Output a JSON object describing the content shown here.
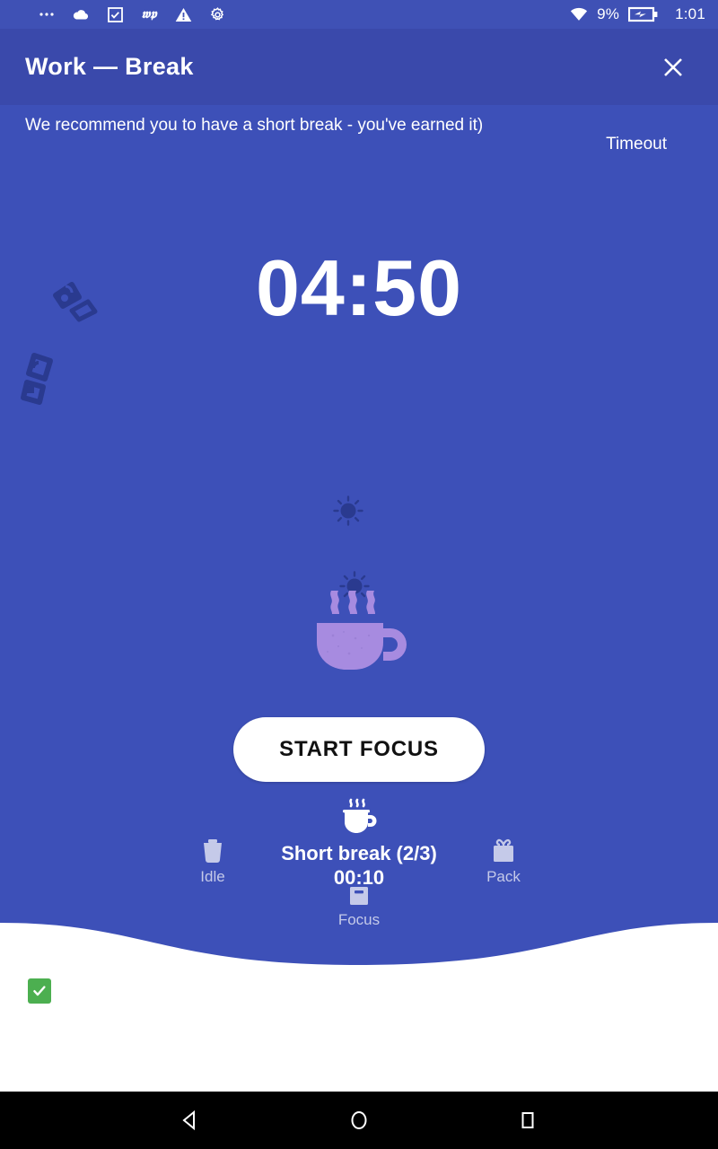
{
  "status_bar": {
    "left_icons": [
      {
        "name": "more-options-icon",
        "glyph": "dots"
      },
      {
        "name": "cloud-icon",
        "glyph": "cloud"
      },
      {
        "name": "checkbox-icon",
        "glyph": "checkbox"
      },
      {
        "name": "washington-post-icon",
        "glyph": "wp"
      },
      {
        "name": "warning-icon",
        "glyph": "warning"
      },
      {
        "name": "settings-gear-icon",
        "glyph": "gear"
      }
    ],
    "wifi_icon": "wifi-icon",
    "battery_percent": "9%",
    "battery_icon": "battery-charging-icon",
    "clock": "1:01"
  },
  "title_bar": {
    "title": "Work — Break",
    "close_label": "✕"
  },
  "break_screen": {
    "recommendation": "We recommend you to have a short break - you've earned it)",
    "timeout_label": "Timeout",
    "timer": "04:50",
    "start_button_label": "START FOCUS",
    "session_label": "Short break (2/3)",
    "session_elapsed": "00:10",
    "states": [
      {
        "name": "idle",
        "label": "Idle",
        "icon": "trash-icon"
      },
      {
        "name": "focus",
        "label": "Focus",
        "icon": "briefcase-icon"
      },
      {
        "name": "pack",
        "label": "Pack",
        "icon": "gift-icon"
      }
    ],
    "colors": {
      "panel_background": "#3d50b8",
      "title_bar": "#3a49ab",
      "status_bar": "#3f51b5",
      "cup_purple": "#a78be0",
      "decoration_navy": "#2a3a8f",
      "state_icon": "#c5cae9",
      "button_background": "#ffffff",
      "check_badge_green": "#4caf50"
    }
  },
  "footer": {
    "check_badge_icon": "green-check-icon"
  },
  "nav_bar": {
    "buttons": [
      {
        "name": "back-button",
        "label": "back-triangle-icon"
      },
      {
        "name": "home-button",
        "label": "home-circle-icon"
      },
      {
        "name": "recents-button",
        "label": "recents-square-icon"
      }
    ]
  }
}
